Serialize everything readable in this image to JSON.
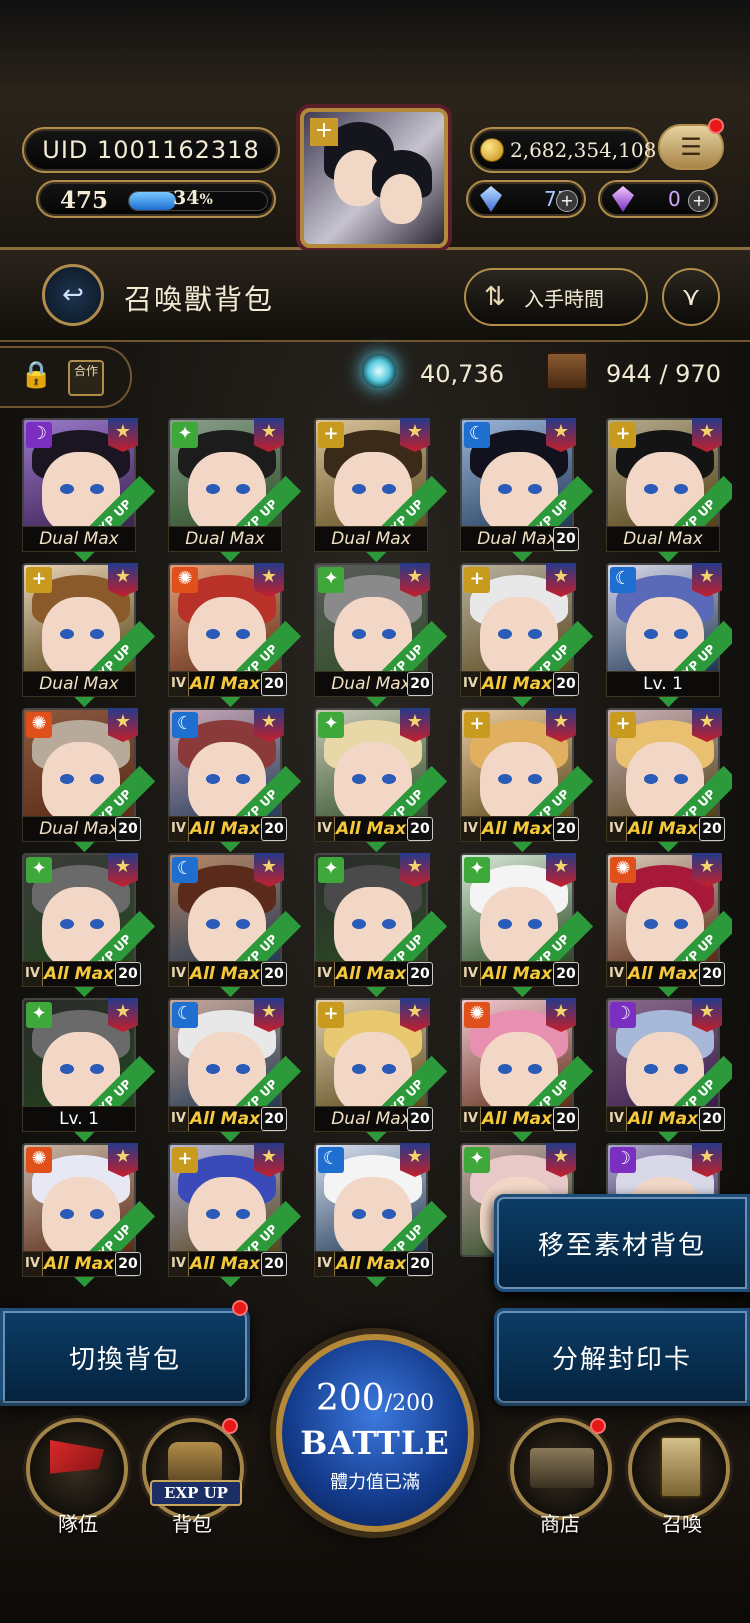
{
  "header": {
    "uid": "UID 1001162318",
    "level": "475",
    "exp_percent": "34",
    "exp_percent_sign": "%",
    "exp_fraction": 0.34,
    "gold": "2,682,354,108",
    "gem_blue": "75",
    "gem_purple": "0",
    "menu_icon": "☰"
  },
  "titlebar": {
    "title": "召喚獸背包",
    "sort_label": "入手時間",
    "sort_icon": "⇅",
    "filter_icon": "⋎",
    "back_icon": "↩"
  },
  "infobar": {
    "lock_icon": "🔒",
    "merge_label": "合作",
    "orb_value": "40,736",
    "capacity": "944 / 970"
  },
  "colors": {
    "light": "#c89a1e",
    "water": "#1f6fd0",
    "fire": "#e0501a",
    "wood": "#3fa83a",
    "dark": "#7a2fc0"
  },
  "cards": [
    {
      "elem": "dark",
      "hair": "#1a1520",
      "bg": "#9a7acc",
      "rank": "",
      "label": "Dual Max",
      "lv": "",
      "style": "dual",
      "exp": "EXP UP"
    },
    {
      "elem": "wood",
      "hair": "#1c1c1c",
      "bg": "#8aa08c",
      "rank": "",
      "label": "Dual Max",
      "lv": "",
      "style": "dual",
      "exp": "EXP UP"
    },
    {
      "elem": "light",
      "hair": "#3a2a1a",
      "bg": "#d8c39a",
      "rank": "",
      "label": "Dual Max",
      "lv": "",
      "style": "dual",
      "exp": "EXP UP"
    },
    {
      "elem": "water",
      "hair": "#12121e",
      "bg": "#9bb4d8",
      "rank": "",
      "label": "Dual Max",
      "lv": "20",
      "style": "dual",
      "exp": "EXP UP"
    },
    {
      "elem": "light",
      "hair": "#141414",
      "bg": "#b3a98c",
      "rank": "",
      "label": "Dual Max",
      "lv": "",
      "style": "dual",
      "exp": "EXP UP"
    },
    {
      "elem": "light",
      "hair": "#8a5a2a",
      "bg": "#e8d3b8",
      "rank": "",
      "label": "Dual Max",
      "lv": "",
      "style": "dual",
      "exp": "EXP UP"
    },
    {
      "elem": "fire",
      "hair": "#b8322a",
      "bg": "#e0a07a",
      "rank": "IV",
      "label": "All Max",
      "lv": "20",
      "style": "all",
      "exp": "EXP UP"
    },
    {
      "elem": "wood",
      "hair": "#8a8a8a",
      "bg": "#5a5a5a",
      "rank": "",
      "label": "Dual Max",
      "lv": "20",
      "style": "dual",
      "exp": "EXP UP"
    },
    {
      "elem": "light",
      "hair": "#e8e8e8",
      "bg": "#b8b0a0",
      "rank": "IV",
      "label": "All Max",
      "lv": "20",
      "style": "all",
      "exp": "EXP UP"
    },
    {
      "elem": "water",
      "hair": "#5a6ab8",
      "bg": "#d8d8ea",
      "rank": "",
      "label": "Lv. 1",
      "lv": "",
      "style": "lvone",
      "exp": "EXP UP"
    },
    {
      "elem": "fire",
      "hair": "#b8aa9a",
      "bg": "#8a5a40",
      "rank": "",
      "label": "Dual Max",
      "lv": "20",
      "style": "dual",
      "exp": "EXP UP"
    },
    {
      "elem": "water",
      "hair": "#8a3a3a",
      "bg": "#c8a8b8",
      "rank": "IV",
      "label": "All Max",
      "lv": "20",
      "style": "all",
      "exp": "EXP UP"
    },
    {
      "elem": "wood",
      "hair": "#e8d8a8",
      "bg": "#c8c8b8",
      "rank": "IV",
      "label": "All Max",
      "lv": "20",
      "style": "all",
      "exp": "EXP UP"
    },
    {
      "elem": "light",
      "hair": "#e0b060",
      "bg": "#e8c8a0",
      "rank": "IV",
      "label": "All Max",
      "lv": "20",
      "style": "all",
      "exp": "EXP UP"
    },
    {
      "elem": "light",
      "hair": "#e8c070",
      "bg": "#c8b0b8",
      "rank": "IV",
      "label": "All Max",
      "lv": "20",
      "style": "all",
      "exp": "EXP UP"
    },
    {
      "elem": "wood",
      "hair": "#6a6a6a",
      "bg": "#3a3a3a",
      "rank": "IV",
      "label": "All Max",
      "lv": "20",
      "style": "all",
      "exp": "EXP UP"
    },
    {
      "elem": "water",
      "hair": "#5a2a1a",
      "bg": "#b88868",
      "rank": "IV",
      "label": "All Max",
      "lv": "20",
      "style": "all",
      "exp": "EXP UP"
    },
    {
      "elem": "wood",
      "hair": "#4a4a4a",
      "bg": "#2a2a2a",
      "rank": "IV",
      "label": "All Max",
      "lv": "20",
      "style": "all",
      "exp": "EXP UP"
    },
    {
      "elem": "wood",
      "hair": "#f4f4f4",
      "bg": "#d8e8d8",
      "rank": "IV",
      "label": "All Max",
      "lv": "20",
      "style": "all",
      "exp": "EXP UP"
    },
    {
      "elem": "fire",
      "hair": "#a81838",
      "bg": "#d8c8b8",
      "rank": "IV",
      "label": "All Max",
      "lv": "20",
      "style": "all",
      "exp": "EXP UP"
    },
    {
      "elem": "wood",
      "hair": "#6a6a6a",
      "bg": "#2a2a2a",
      "rank": "",
      "label": "Lv. 1",
      "lv": "",
      "style": "lvone",
      "exp": "EXP UP"
    },
    {
      "elem": "water",
      "hair": "#e8e8e8",
      "bg": "#c8a898",
      "rank": "IV",
      "label": "All Max",
      "lv": "20",
      "style": "all",
      "exp": "EXP UP"
    },
    {
      "elem": "light",
      "hair": "#e8c870",
      "bg": "#e0d0b0",
      "rank": "",
      "label": "Dual Max",
      "lv": "20",
      "style": "dual",
      "exp": "EXP UP"
    },
    {
      "elem": "fire",
      "hair": "#e890b0",
      "bg": "#f0c8d0",
      "rank": "IV",
      "label": "All Max",
      "lv": "20",
      "style": "all",
      "exp": "EXP UP"
    },
    {
      "elem": "dark",
      "hair": "#a8b8d8",
      "bg": "#8a6a8a",
      "rank": "IV",
      "label": "All Max",
      "lv": "20",
      "style": "all",
      "exp": "EXP UP"
    },
    {
      "elem": "fire",
      "hair": "#e8e8f4",
      "bg": "#c8b8a8",
      "rank": "IV",
      "label": "All Max",
      "lv": "20",
      "style": "all",
      "exp": "EXP UP"
    },
    {
      "elem": "light",
      "hair": "#3a4ab8",
      "bg": "#b8b8e0",
      "rank": "IV",
      "label": "All Max",
      "lv": "20",
      "style": "all",
      "exp": "EXP UP"
    },
    {
      "elem": "water",
      "hair": "#f4f4f4",
      "bg": "#d8e0f0",
      "rank": "IV",
      "label": "All Max",
      "lv": "20",
      "style": "all",
      "exp": "EXP UP"
    },
    {
      "elem": "wood",
      "hair": "#e8c8c8",
      "bg": "#c8a8a8",
      "rank": "IV",
      "label": "",
      "lv": "",
      "style": "all",
      "exp": ""
    },
    {
      "elem": "dark",
      "hair": "#d8d8e8",
      "bg": "#a8a8c8",
      "rank": "",
      "label": "",
      "lv": "",
      "style": "all",
      "exp": ""
    }
  ],
  "popups": {
    "material": "移至素材背包",
    "decompose": "分解封印卡",
    "switch": "切換背包"
  },
  "nav": {
    "team": "隊伍",
    "bag": "背包",
    "bag_badge": "EXP UP",
    "shop": "商店",
    "summon": "召喚",
    "stamina_current": "200",
    "stamina_max": "/200",
    "battle_label": "BATTLE",
    "stamina_status": "體力值已滿"
  }
}
